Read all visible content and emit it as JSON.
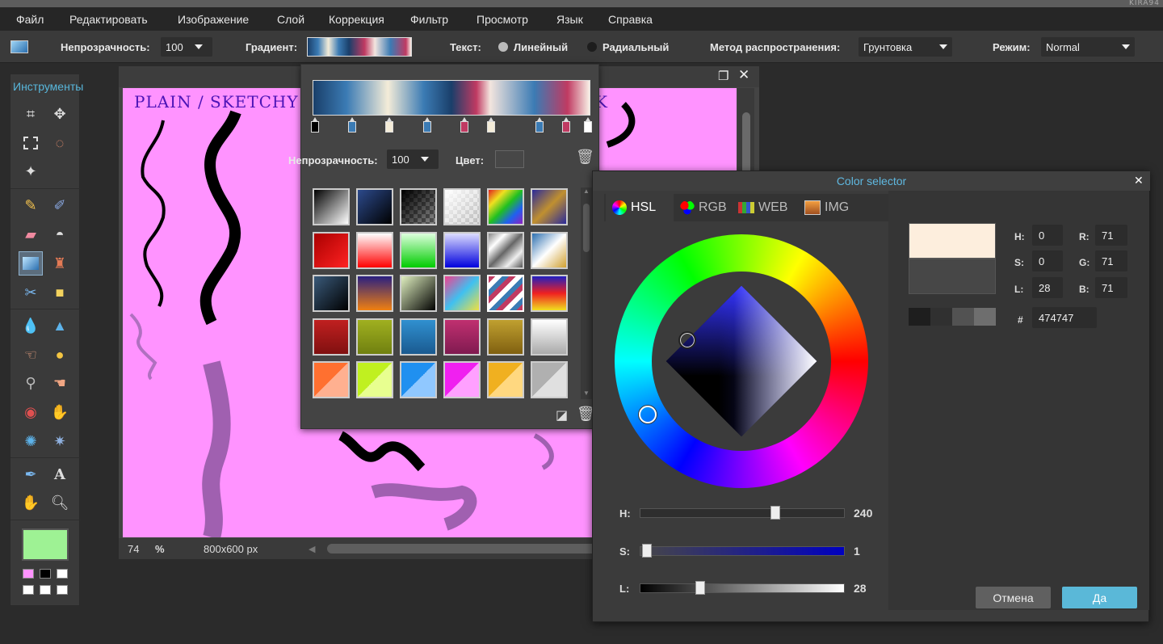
{
  "watermark": "KIRA94",
  "menu": [
    "Файл",
    "Редактировать",
    "Изображение",
    "Слой",
    "Коррекция",
    "Фильтр",
    "Просмотр",
    "Язык",
    "Справка"
  ],
  "toolbar": {
    "opacity_label": "Непрозрачность:",
    "opacity_value": "100",
    "gradient_label": "Градиент:",
    "text_label": "Текст:",
    "linear_label": "Линейный",
    "radial_label": "Радиальный",
    "spread_label": "Метод распространения:",
    "spread_value": "Грунтовка",
    "mode_label": "Режим:",
    "mode_value": "Normal"
  },
  "tools": {
    "title": "Инструменты"
  },
  "canvas": {
    "heading": "PLAIN / SKETCHY / TE",
    "heading_tail": "K",
    "zoom": "74",
    "zoom_unit": "%",
    "size": "800x600 px"
  },
  "gradient_popup": {
    "opacity_label": "Непрозрачность:",
    "opacity_value": "100",
    "color_label": "Цвет:"
  },
  "color_selector": {
    "title": "Color selector",
    "tabs": [
      "HSL",
      "RGB",
      "WEB",
      "IMG"
    ],
    "h_label": "H:",
    "h_value": "0",
    "s_label": "S:",
    "s_value": "0",
    "l_label": "L:",
    "l_value": "28",
    "r_label": "R:",
    "r_value": "71",
    "g_label": "G:",
    "g_value": "71",
    "b_label": "B:",
    "b_value": "71",
    "hash_label": "#",
    "hex_value": "474747",
    "slider_h_label": "H:",
    "slider_h_value": "240",
    "slider_s_label": "S:",
    "slider_s_value": "1",
    "slider_l_label": "L:",
    "slider_l_value": "28",
    "slider_h_fraction": 0.667,
    "slider_s_fraction": 0.01,
    "slider_l_fraction": 0.28,
    "new_color": "#fdeedd",
    "old_color": "#474747",
    "cancel_label": "Отмена",
    "ok_label": "Да"
  }
}
